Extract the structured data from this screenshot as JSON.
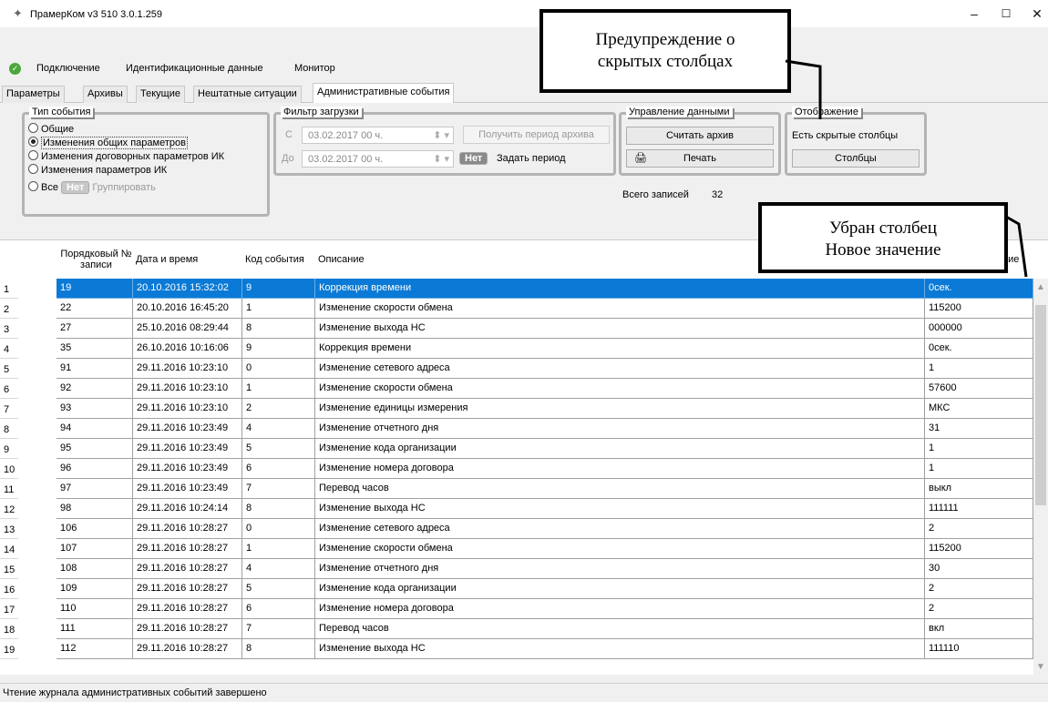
{
  "window": {
    "title": "ПрамерКом v3 510 3.0.1.259",
    "minimize": "–",
    "maximize": "☐",
    "close": "✕"
  },
  "menu": [
    "Подключение",
    "Идентификационные данные",
    "Монитор"
  ],
  "tabs": [
    {
      "label": "Параметры",
      "active": false
    },
    {
      "label": "Архивы",
      "active": false
    },
    {
      "label": "Текущие",
      "active": false
    },
    {
      "label": "Нештатные ситуации",
      "active": false
    },
    {
      "label": "Административные события",
      "active": true
    }
  ],
  "event_type": {
    "title": "Тип события",
    "options": [
      {
        "label": "Общие",
        "selected": false
      },
      {
        "label": "Изменения общих параметров",
        "selected": true
      },
      {
        "label": "Изменения договорных параметров ИК",
        "selected": false
      },
      {
        "label": "Изменения параметров ИК",
        "selected": false
      }
    ],
    "all_label": "Все",
    "toggle_label": "Нет",
    "group_label": "Группировать"
  },
  "filter": {
    "title": "Фильтр загрузки",
    "from_label": "С",
    "from_value": "03.02.2017   00 ч.",
    "to_label": "До",
    "to_value": "03.02.2017   00 ч.",
    "get_period_button": "Получить период архива",
    "toggle_label": "Нет",
    "set_period_label": "Задать период"
  },
  "data_management": {
    "title": "Управление данными",
    "read_button": "Считать архив",
    "print_button": "Печать",
    "total_label": "Всего записей",
    "total_value": "32"
  },
  "display": {
    "title": "Отображение",
    "hidden_columns_label": "Есть скрытые столбцы",
    "columns_button": "Столбцы"
  },
  "grid": {
    "headers": [
      "Порядковый № записи",
      "Дата и время",
      "Код события",
      "Описание",
      "ние"
    ],
    "rows": [
      [
        "1",
        "19",
        "20.10.2016 15:32:02",
        "9",
        "Коррекция времени",
        "0сек."
      ],
      [
        "2",
        "22",
        "20.10.2016 16:45:20",
        "1",
        "Изменение скорости обмена",
        "115200"
      ],
      [
        "3",
        "27",
        "25.10.2016 08:29:44",
        "8",
        "Изменение выхода НС",
        "000000"
      ],
      [
        "4",
        "35",
        "26.10.2016 10:16:06",
        "9",
        "Коррекция времени",
        "0сек."
      ],
      [
        "5",
        "91",
        "29.11.2016 10:23:10",
        "0",
        "Изменение сетевого адреса",
        "1"
      ],
      [
        "6",
        "92",
        "29.11.2016 10:23:10",
        "1",
        "Изменение скорости обмена",
        "57600"
      ],
      [
        "7",
        "93",
        "29.11.2016 10:23:10",
        "2",
        "Изменение единицы измерения",
        "МКС"
      ],
      [
        "8",
        "94",
        "29.11.2016 10:23:49",
        "4",
        "Изменение отчетного дня",
        "31"
      ],
      [
        "9",
        "95",
        "29.11.2016 10:23:49",
        "5",
        "Изменение кода организации",
        "1"
      ],
      [
        "10",
        "96",
        "29.11.2016 10:23:49",
        "6",
        "Изменение номера договора",
        "1"
      ],
      [
        "11",
        "97",
        "29.11.2016 10:23:49",
        "7",
        "Перевод часов",
        "выкл"
      ],
      [
        "12",
        "98",
        "29.11.2016 10:24:14",
        "8",
        "Изменение выхода НС",
        "111111"
      ],
      [
        "13",
        "106",
        "29.11.2016 10:28:27",
        "0",
        "Изменение сетевого адреса",
        "2"
      ],
      [
        "14",
        "107",
        "29.11.2016 10:28:27",
        "1",
        "Изменение скорости обмена",
        "115200"
      ],
      [
        "15",
        "108",
        "29.11.2016 10:28:27",
        "4",
        "Изменение отчетного дня",
        "30"
      ],
      [
        "16",
        "109",
        "29.11.2016 10:28:27",
        "5",
        "Изменение кода организации",
        "2"
      ],
      [
        "17",
        "110",
        "29.11.2016 10:28:27",
        "6",
        "Изменение номера договора",
        "2"
      ],
      [
        "18",
        "111",
        "29.11.2016 10:28:27",
        "7",
        "Перевод часов",
        "вкл"
      ],
      [
        "19",
        "112",
        "29.11.2016 10:28:27",
        "8",
        "Изменение выхода НС",
        "111110"
      ]
    ],
    "selected_row": 0
  },
  "status": "Чтение журнала административных событий завершено",
  "callouts": {
    "hidden_warning_line1": "Предупреждение о",
    "hidden_warning_line2": "скрытых столбцах",
    "removed_line1": "Убран столбец",
    "removed_line2": "Новое значение"
  },
  "colors": {
    "selection": "#0a7ad6",
    "status_ok": "#4aa83b"
  }
}
